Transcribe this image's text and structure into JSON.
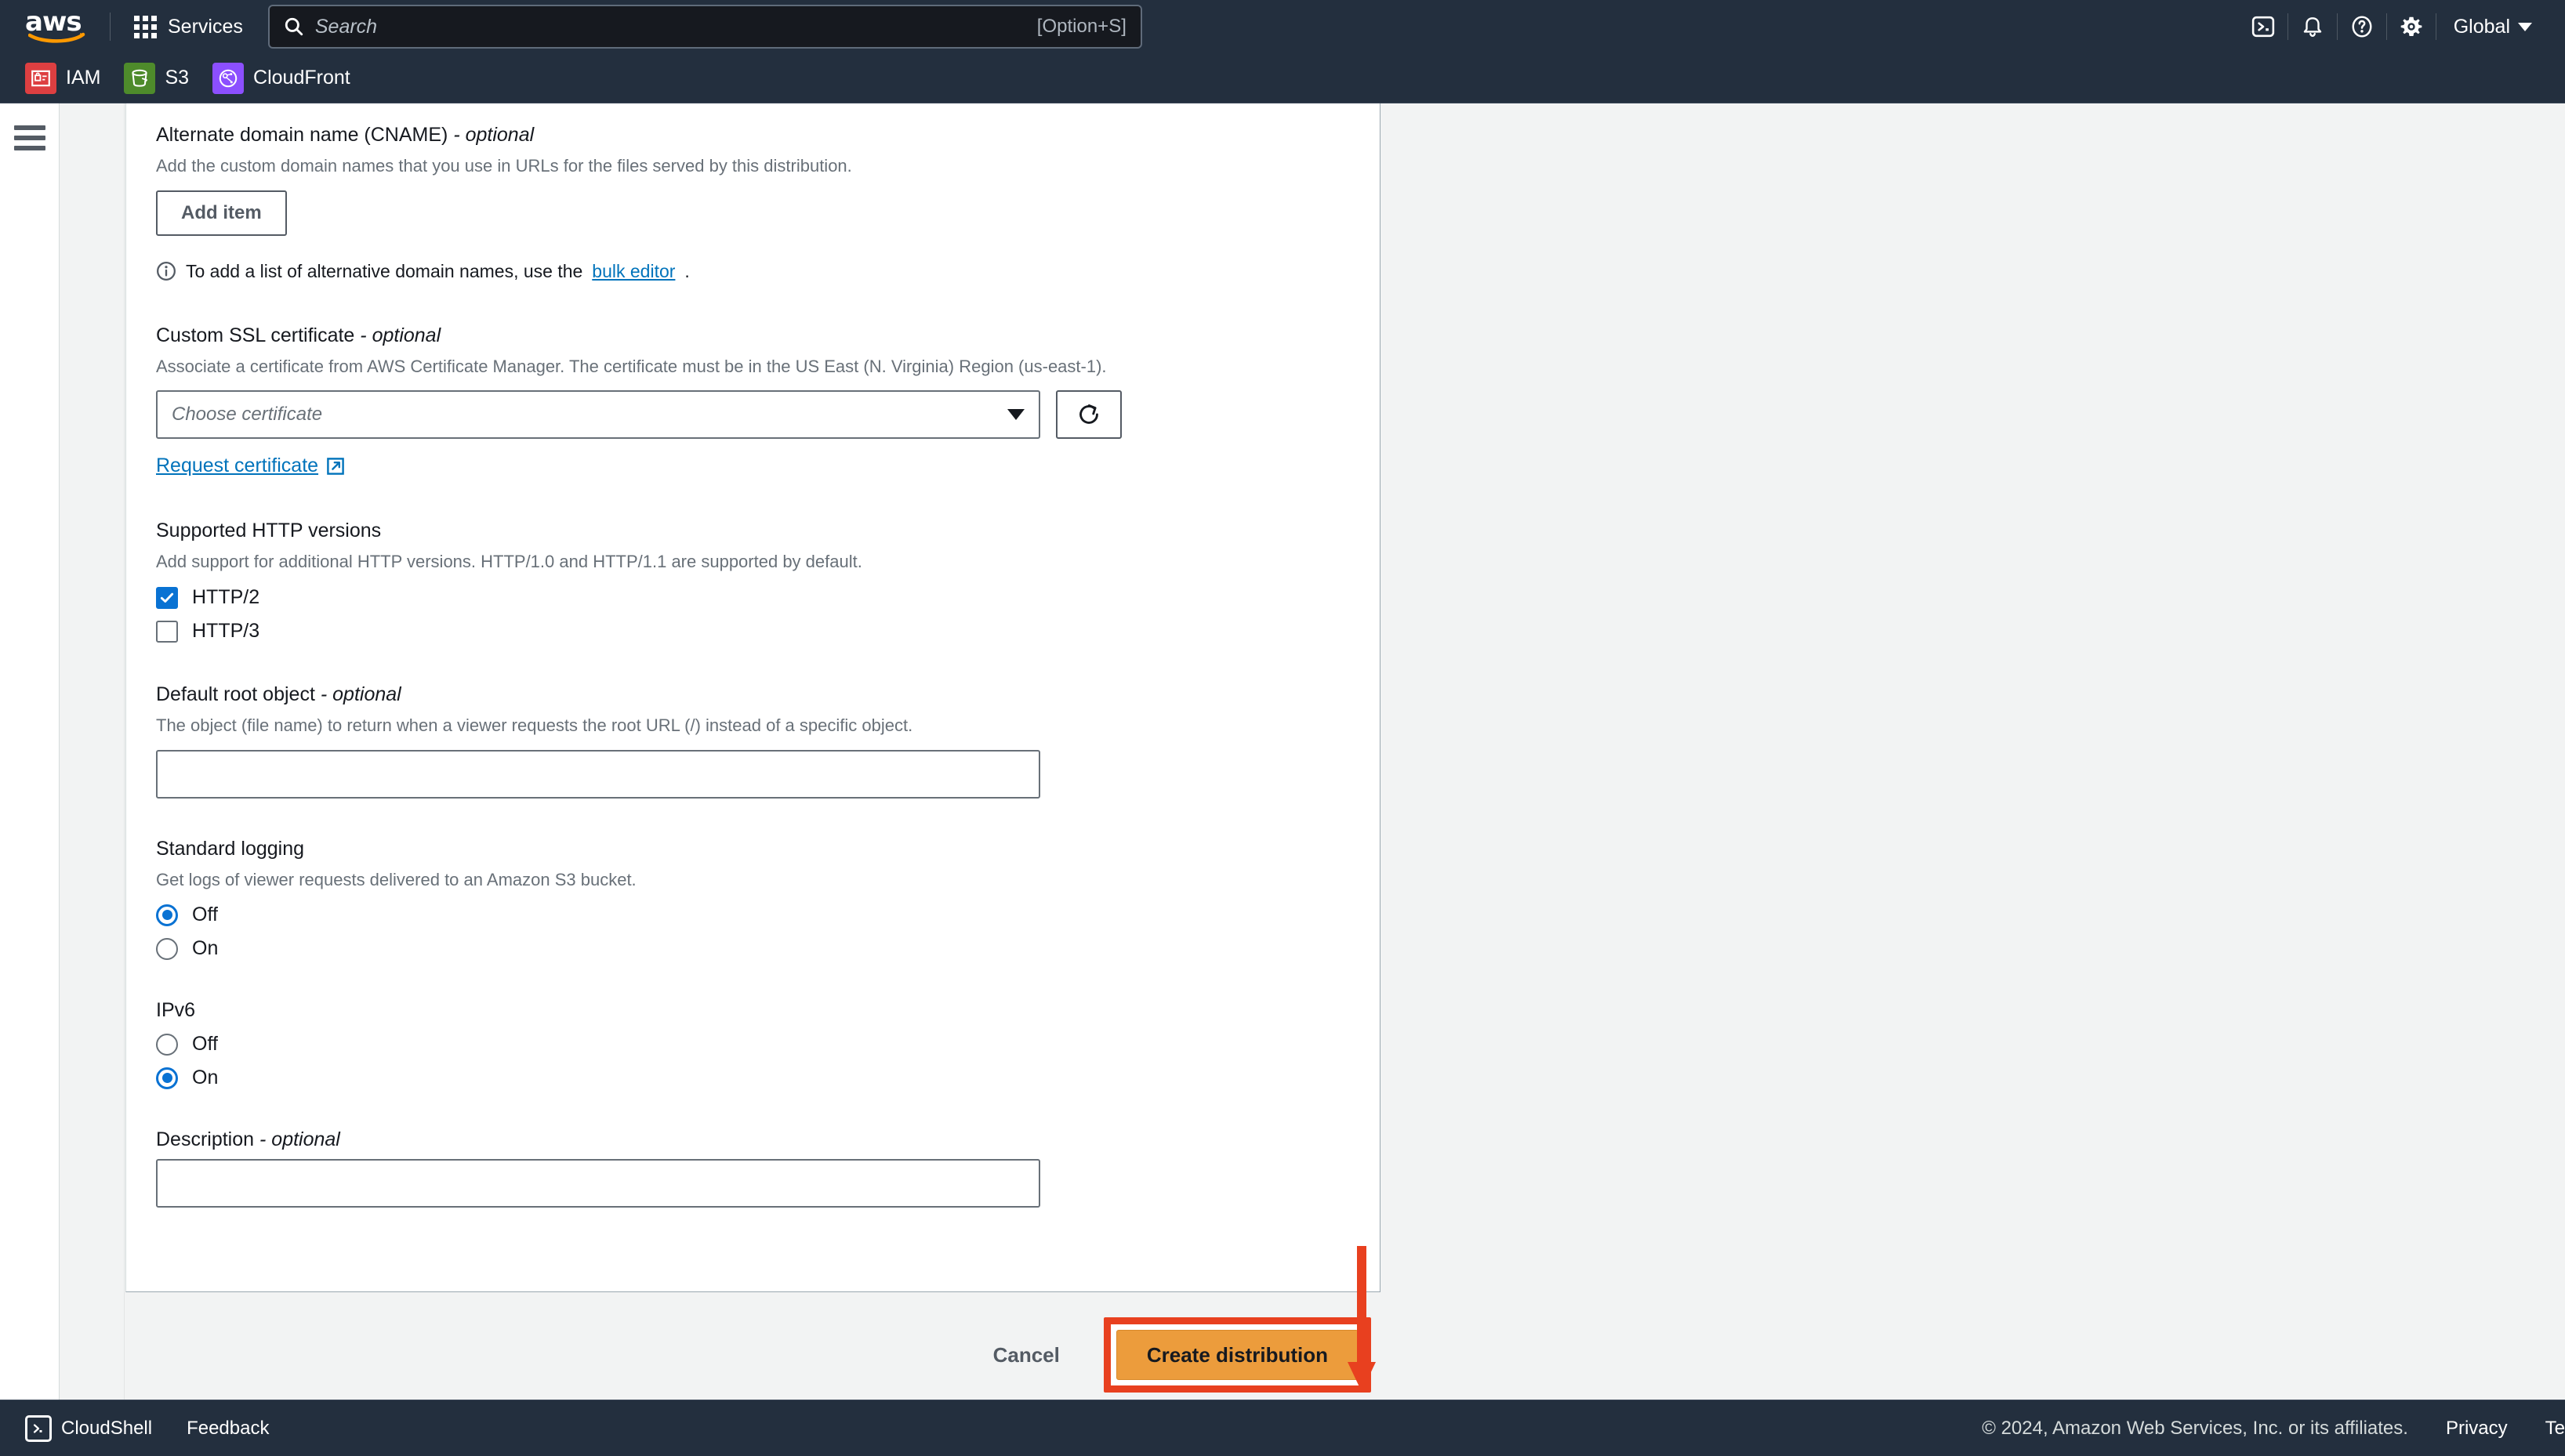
{
  "topnav": {
    "logo_alt": "aws",
    "services_label": "Services",
    "search": {
      "placeholder": "Search",
      "shortcut_hint": "[Option+S]"
    },
    "icons": [
      {
        "name": "cloudshell-icon",
        "label": "CloudShell"
      },
      {
        "name": "notifications-bell-icon",
        "label": "Notifications"
      },
      {
        "name": "help-question-icon",
        "label": "Help"
      },
      {
        "name": "settings-gear-icon",
        "label": "Settings"
      }
    ],
    "region_label": "Global"
  },
  "shortcuts": [
    {
      "label": "IAM",
      "color": "#dd3f41",
      "icon": "iam-icon"
    },
    {
      "label": "S3",
      "color": "#4e8b2b",
      "icon": "s3-bucket-icon"
    },
    {
      "label": "CloudFront",
      "color": "#8c4fff",
      "icon": "cloudfront-globe-icon"
    }
  ],
  "form": {
    "cname": {
      "label": "Alternate domain name (CNAME)",
      "optional_suffix": "- optional",
      "description": "Add the custom domain names that you use in URLs for the files served by this distribution.",
      "add_item_label": "Add item",
      "info_text_before": "To add a list of alternative domain names, use the",
      "info_link": "bulk editor",
      "info_text_after": "."
    },
    "ssl": {
      "label": "Custom SSL certificate",
      "optional_suffix": "- optional",
      "description": "Associate a certificate from AWS Certificate Manager. The certificate must be in the US East (N. Virginia) Region (us-east-1).",
      "select_placeholder": "Choose certificate",
      "refresh_icon": "refresh-icon",
      "request_link": "Request certificate"
    },
    "http_versions": {
      "label": "Supported HTTP versions",
      "description": "Add support for additional HTTP versions. HTTP/1.0 and HTTP/1.1 are supported by default.",
      "options": [
        {
          "label": "HTTP/2",
          "checked": true
        },
        {
          "label": "HTTP/3",
          "checked": false
        }
      ]
    },
    "default_root_object": {
      "label": "Default root object",
      "optional_suffix": "- optional",
      "description": "The object (file name) to return when a viewer requests the root URL (/) instead of a specific object.",
      "value": ""
    },
    "standard_logging": {
      "label": "Standard logging",
      "description": "Get logs of viewer requests delivered to an Amazon S3 bucket.",
      "options": [
        {
          "label": "Off",
          "selected": true
        },
        {
          "label": "On",
          "selected": false
        }
      ]
    },
    "ipv6": {
      "label": "IPv6",
      "options": [
        {
          "label": "Off",
          "selected": false
        },
        {
          "label": "On",
          "selected": true
        }
      ]
    },
    "description_field": {
      "label": "Description",
      "optional_suffix": "- optional",
      "value": ""
    }
  },
  "actions": {
    "cancel_label": "Cancel",
    "create_label": "Create distribution",
    "highlight_color": "#e8401f",
    "create_button_color": "#ec9c3c"
  },
  "annotation": {
    "arrow_color": "#e8401f",
    "arrow_direction": "down",
    "points_at": "create-distribution-button"
  },
  "footer": {
    "cloudshell_label": "CloudShell",
    "feedback_label": "Feedback",
    "copyright": "© 2024, Amazon Web Services, Inc. or its affiliates.",
    "privacy_label": "Privacy",
    "terms_label": "Te"
  }
}
